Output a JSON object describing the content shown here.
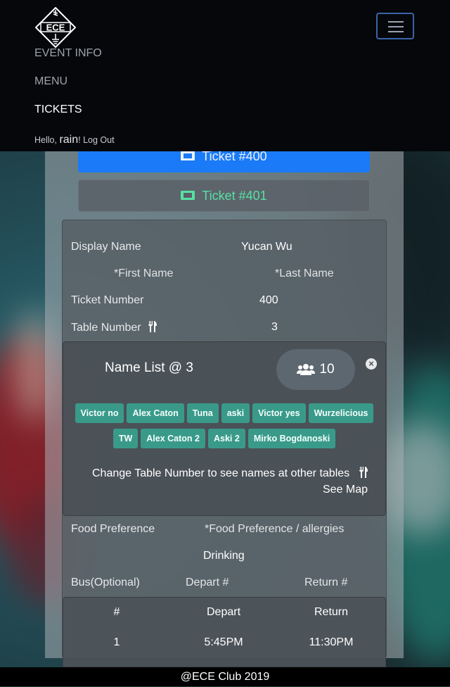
{
  "nav": {
    "logo_text": "ECE",
    "links": [
      "EVENT INFO",
      "MENU",
      "TICKETS"
    ],
    "hello_prefix": "Hello, ",
    "username": "rain",
    "hello_suffix": "!",
    "logout": "Log Out"
  },
  "tickets": {
    "active": "Ticket #400",
    "other": "Ticket #401"
  },
  "form": {
    "display_name_label": "Display Name",
    "display_name_value": "Yucan Wu",
    "first_name_placeholder": "*First Name",
    "last_name_placeholder": "*Last Name",
    "ticket_number_label": "Ticket Number",
    "ticket_number_value": "400",
    "table_number_label": "Table Number",
    "table_number_value": "3",
    "food_label": "Food Preference",
    "food_placeholder": "*Food Preference / allergies",
    "drinking_value": "Drinking",
    "bus_label": "Bus(Optional)",
    "depart_placeholder": "Depart #",
    "return_placeholder": "Return #"
  },
  "name_list": {
    "title": "Name List @ 3",
    "count": "10",
    "close": "×",
    "row1": [
      "Victor no",
      "Alex Caton",
      "Tuna",
      "aski",
      "Victor yes",
      "Wurzelicious"
    ],
    "row2": [
      "TW",
      "Alex Caton 2",
      "Aski 2",
      "Mirko Bogdanoski"
    ],
    "note": "Change Table Number to see names at other tables",
    "see_map": "See Map"
  },
  "bus_table": {
    "headers": [
      "#",
      "Depart",
      "Return"
    ],
    "rows": [
      [
        "1",
        "5:45PM",
        "11:30PM"
      ]
    ]
  },
  "footer": "@ECE Club 2019",
  "colors": {
    "primary": "#1a7af8",
    "chip": "#3a9a8a",
    "ticket_green": "#57e0a3",
    "navbar": "#05070b"
  }
}
